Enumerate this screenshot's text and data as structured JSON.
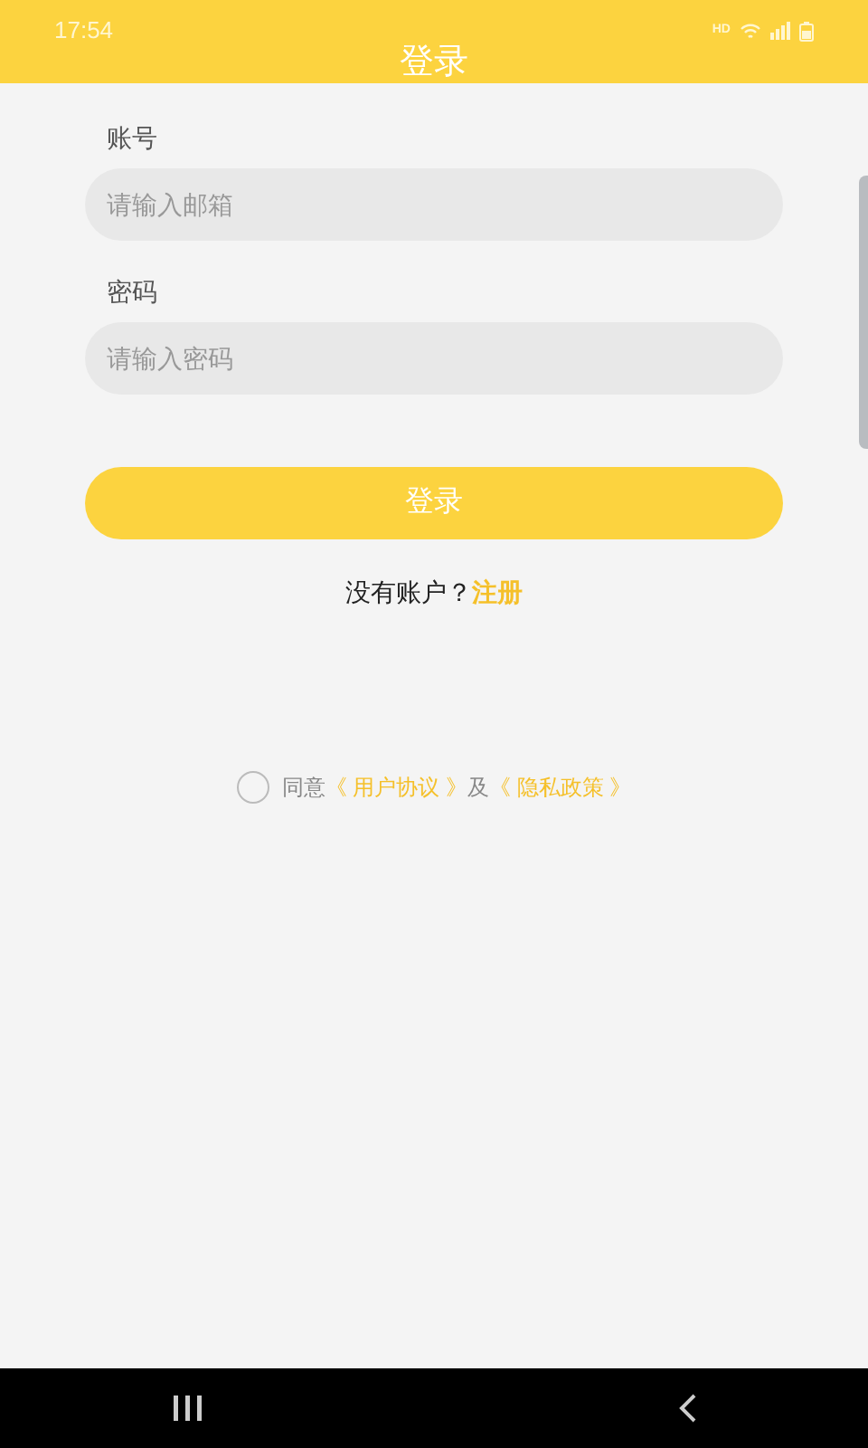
{
  "status_bar": {
    "time": "17:54",
    "network_label": "HD"
  },
  "header": {
    "title": "登录"
  },
  "fields": [
    {
      "label": "账号",
      "placeholder": "请输入邮箱"
    },
    {
      "label": "密码",
      "placeholder": "请输入密码"
    }
  ],
  "login_button": "登录",
  "register": {
    "prompt": "没有账户？",
    "link": "注册"
  },
  "agreement": {
    "checked": false,
    "prefix": "同意",
    "terms_link": "《 用户协议 》",
    "joiner": "及",
    "privacy_link": "《 隐私政策 》"
  }
}
